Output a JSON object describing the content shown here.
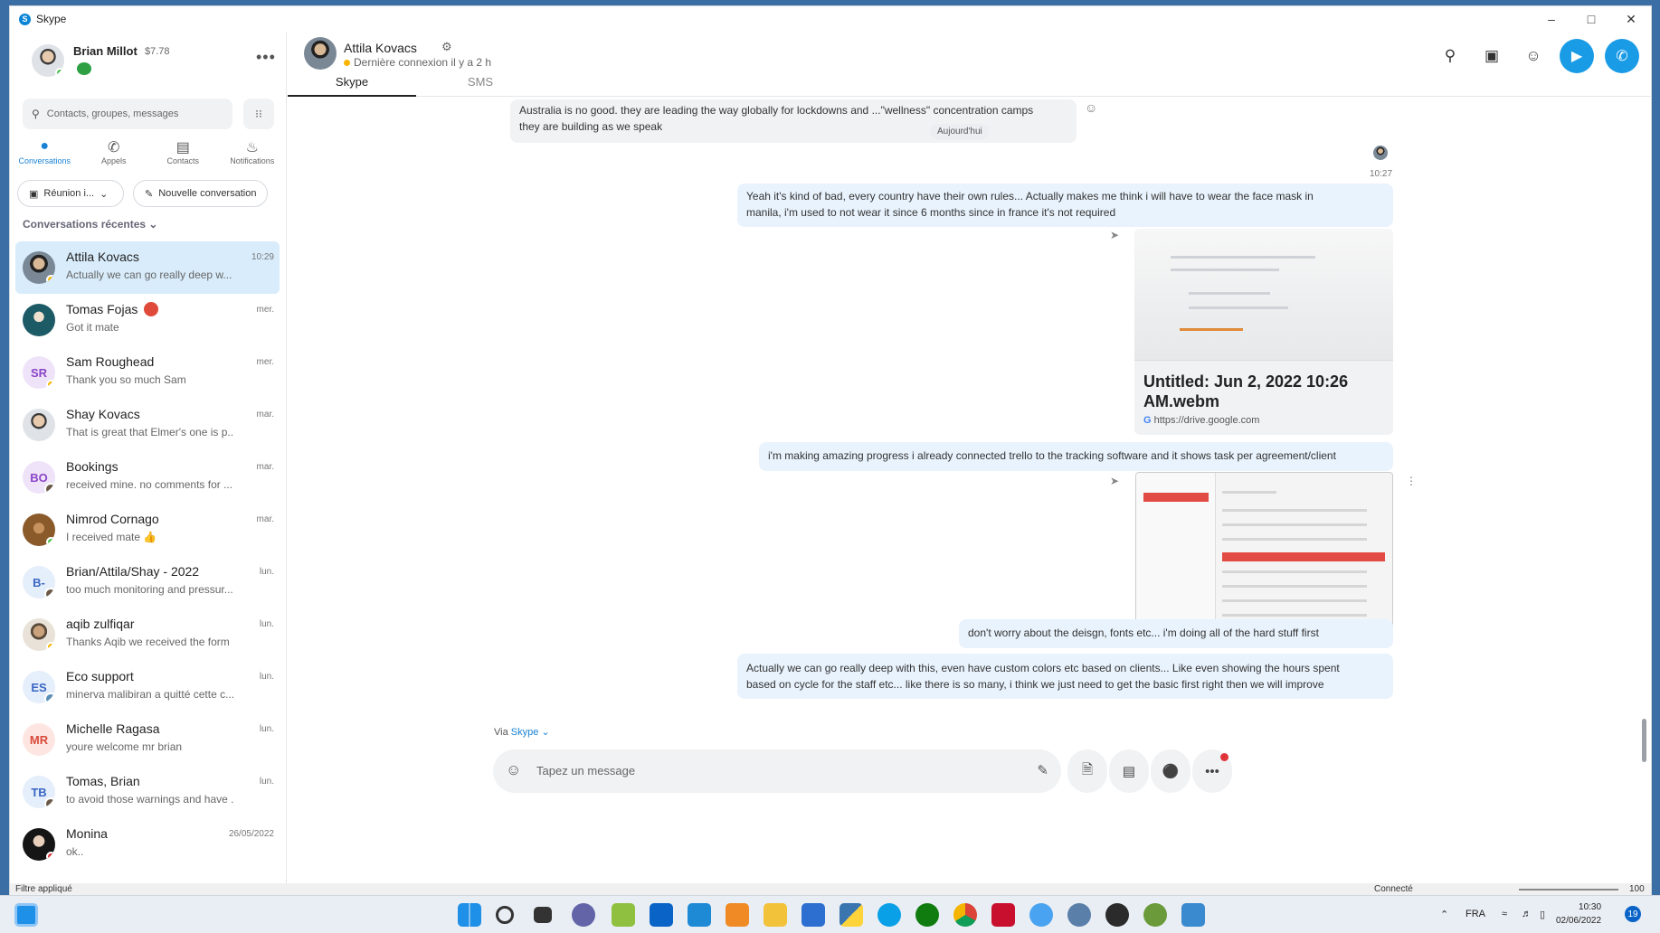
{
  "window": {
    "title": "Skype"
  },
  "profile": {
    "name": "Brian Millot",
    "credit": "$7.78"
  },
  "search": {
    "placeholder": "Contacts, groupes, messages"
  },
  "nav": [
    {
      "label": "Conversations",
      "icon": "chat-icon"
    },
    {
      "label": "Appels",
      "icon": "phone-icon"
    },
    {
      "label": "Contacts",
      "icon": "contacts-icon"
    },
    {
      "label": "Notifications",
      "icon": "bell-icon"
    }
  ],
  "buttons": {
    "meeting": "Réunion i...",
    "new_conversation": "Nouvelle conversation"
  },
  "recent_label": "Conversations récentes",
  "conversations": [
    {
      "name": "Attila Kovacs",
      "preview": "Actually we can go really deep w...",
      "time": "10:29"
    },
    {
      "name": "Tomas Fojas",
      "preview": "Got it mate",
      "time": "mer."
    },
    {
      "name": "Sam Roughead",
      "preview": "Thank you so much Sam",
      "time": "mer.",
      "initials": "SR"
    },
    {
      "name": "Shay Kovacs",
      "preview": "That is great that Elmer's one is p...",
      "time": "mar."
    },
    {
      "name": "Bookings",
      "preview": "received mine. no comments for ...",
      "time": "mar.",
      "initials": "BO"
    },
    {
      "name": "Nimrod Cornago",
      "preview": "I received mate 👍",
      "time": "mar."
    },
    {
      "name": "Brian/Attila/Shay - 2022",
      "preview": "too much monitoring and pressur...",
      "time": "lun.",
      "initials": "B-"
    },
    {
      "name": "aqib zulfiqar",
      "preview": "Thanks Aqib we received the form",
      "time": "lun."
    },
    {
      "name": "Eco support",
      "preview": "minerva malibiran a quitté cette c...",
      "time": "lun.",
      "initials": "ES"
    },
    {
      "name": "Michelle Ragasa",
      "preview": "youre welcome mr brian",
      "time": "lun.",
      "initials": "MR"
    },
    {
      "name": "Tomas, Brian",
      "preview": "to avoid those warnings and have ...",
      "time": "lun.",
      "initials": "TB"
    },
    {
      "name": "Monina",
      "preview": "ok..",
      "time": "26/05/2022"
    }
  ],
  "chat": {
    "contact": "Attila Kovacs",
    "last_seen": "Dernière connexion il y a 2 h",
    "tabs": [
      "Skype",
      "SMS"
    ],
    "day_chip": "Aujourd'hui",
    "messages": {
      "m1": "Australia is no good. they are leading the way globally for lockdowns and ...\"wellness\" concentration camps",
      "m1b": "they are building as we speak",
      "time1": "10:27",
      "m2": "Yeah it's kind of bad, every country have their own rules... Actually makes me think i will have to wear the face mask in",
      "m2b": "manila, i'm used to not wear it since 6 months since in france it's not required",
      "link_title": "Untitled: Jun 2, 2022 10:26 AM.webm",
      "link_url": "https://drive.google.com",
      "m3": "i'm making amazing progress i already connected trello to the tracking software and it shows task per agreement/client",
      "m4": "don't worry about the deisgn, fonts etc... i'm doing all of the hard stuff first",
      "m5": "Actually we can go really deep with this, even have custom colors etc based on clients... Like even showing the hours spent",
      "m5b": "based on cycle for the staff etc... like there is so many, i think we just need to get the basic first right then we will improve"
    },
    "via": "Via",
    "via_link": "Skype",
    "composer_placeholder": "Tapez un message"
  },
  "statusbar": {
    "left": "Filtre appliqué",
    "right": "Connecté",
    "zoom": "100 %"
  },
  "taskbar": {
    "lang": "FRA",
    "time": "10:30",
    "date": "02/06/2022",
    "notifications": "19"
  }
}
